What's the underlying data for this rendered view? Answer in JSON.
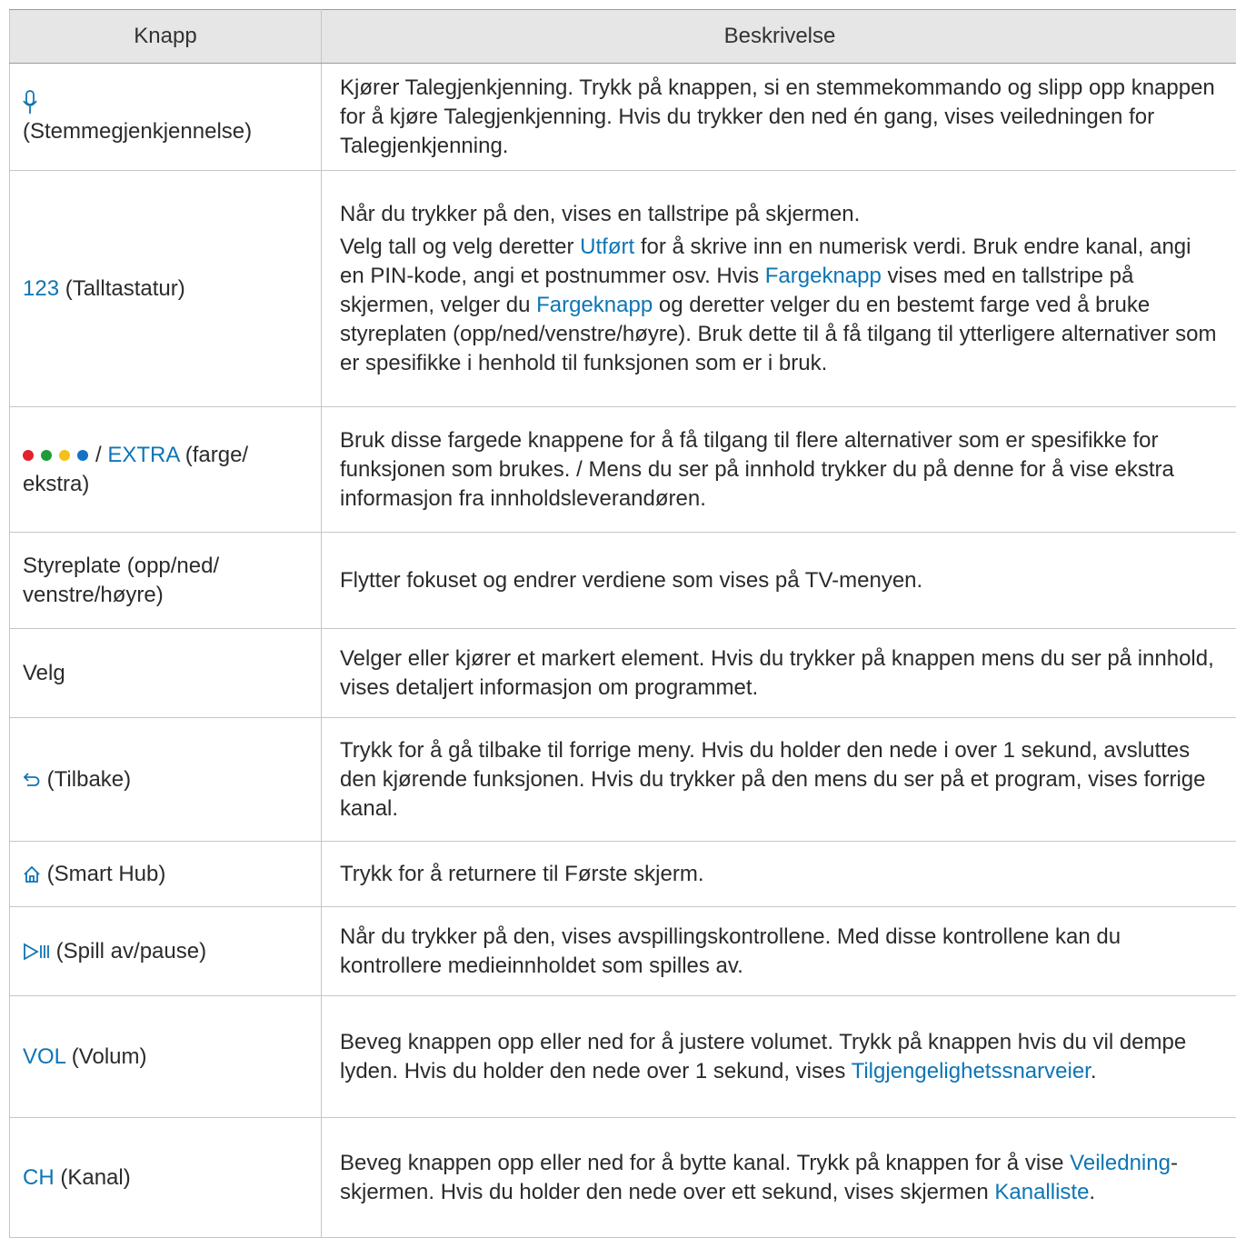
{
  "colors": {
    "accent": "#0e75b5",
    "red": "#e5202e",
    "green": "#1f9b3a",
    "yellow": "#f2c21b",
    "blue": "#1572c3"
  },
  "header": {
    "knapp": "Knapp",
    "beskrivelse": "Beskrivelse"
  },
  "rows": {
    "voice": {
      "icon": "microphone-icon",
      "label": "(Stemmegjenkjennelse)",
      "desc": "Kjører Talegjenkjenning. Trykk på knappen, si en stemmekommando og slipp opp knappen for å kjøre Talegjenkjenning. Hvis du trykker den ned én gang, vises veiledningen for Talegjenkjenning."
    },
    "numpad": {
      "key": "123",
      "label": " (Talltastatur)",
      "desc1": "Når du trykker på den, vises en tallstripe på skjermen.",
      "d2a": "Velg tall og velg deretter ",
      "d2b": "Utført",
      "d2c": " for å skrive inn en numerisk verdi. Bruk endre kanal, angi en PIN-kode, angi et postnummer osv. Hvis ",
      "d2d": "Fargeknapp",
      "d2e": " vises med en tallstripe på skjermen, velger du ",
      "d2f": "Fargeknapp",
      "d2g": " og deretter velger du en bestemt farge ved å bruke styreplaten (opp/ned/venstre/høyre). Bruk dette til å få tilgang til ytterligere alternativer som er spesifikke i henhold til funksjonen som er i bruk."
    },
    "color": {
      "sep": "/ ",
      "key": "EXTRA",
      "label": " (farge/ ekstra)",
      "desc": "Bruk disse fargede knappene for å få tilgang til flere alternativer som er spesifikke for funksjonen som brukes. / Mens du ser på innhold trykker du på denne for å vise ekstra informasjon fra innholdsleverandøren."
    },
    "pad": {
      "label": "Styreplate (opp/ned/ venstre/høyre)",
      "desc": "Flytter fokuset og endrer verdiene som vises på TV-menyen."
    },
    "select": {
      "label": "Velg",
      "desc": "Velger eller kjører et markert element. Hvis du trykker på knappen mens du ser på innhold, vises detaljert informasjon om programmet."
    },
    "back": {
      "icon": "back-arrow-icon",
      "label": " (Tilbake)",
      "desc": "Trykk for å gå tilbake til forrige meny. Hvis du holder den nede i over 1 sekund, avsluttes den kjørende funksjonen. Hvis du trykker på den mens du ser på et program, vises forrige kanal."
    },
    "home": {
      "icon": "home-icon",
      "label": " (Smart Hub)",
      "desc": "Trykk for å returnere til Første skjerm."
    },
    "play": {
      "icon": "play-pause-icon",
      "label": " (Spill av/pause)",
      "desc": "Når du trykker på den, vises avspillingskontrollene. Med disse kontrollene kan du kontrollere medieinnholdet som spilles av."
    },
    "vol": {
      "key": "VOL",
      "label": " (Volum)",
      "d1": "Beveg knappen opp eller ned for å justere volumet. Trykk på knappen hvis du vil dempe lyden. Hvis du holder den nede over 1 sekund, vises ",
      "d2": "Tilgjengelighetssnarveier",
      "d3": "."
    },
    "ch": {
      "key": "CH",
      "label": " (Kanal)",
      "d1": "Beveg knappen opp eller ned for å bytte kanal. Trykk på knappen for å vise ",
      "d2": "Veiledning",
      "d3": "-skjermen. Hvis du holder den nede over ett sekund, vises skjermen ",
      "d4": "Kanalliste",
      "d5": "."
    }
  }
}
